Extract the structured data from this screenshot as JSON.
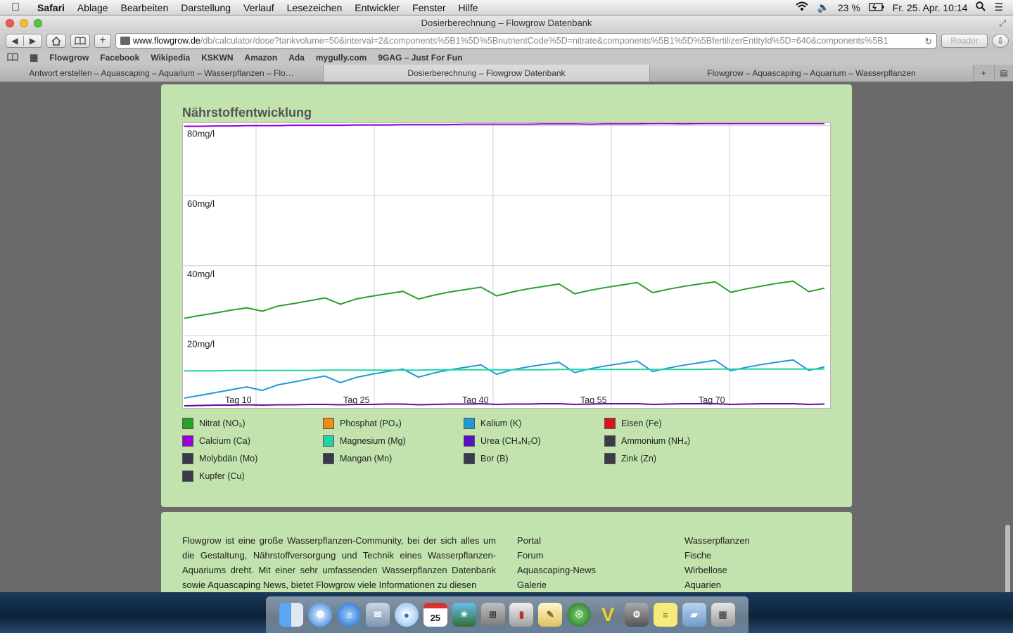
{
  "menubar": {
    "app": "Safari",
    "items": [
      "Ablage",
      "Bearbeiten",
      "Darstellung",
      "Verlauf",
      "Lesezeichen",
      "Entwickler",
      "Fenster",
      "Hilfe"
    ],
    "battery": "23 %",
    "clock": "Fr. 25. Apr.  10:14"
  },
  "window": {
    "title": "Dosierberechnung – Flowgrow Datenbank"
  },
  "toolbar": {
    "url_host": "www.flowgrow.de",
    "url_rest": "/db/calculator/dose?tankvolume=50&interval=2&components%5B1%5D%5BnutrientCode%5D=nitrate&components%5B1%5D%5BfertilizerEntityId%5D=640&components%5B1",
    "reader_label": "Reader"
  },
  "bookmarks": [
    "Flowgrow",
    "Facebook",
    "Wikipedia",
    "KSKWN",
    "Amazon",
    "Ada",
    "mygully.com",
    "9GAG – Just For Fun"
  ],
  "tabs": [
    {
      "label": "Antwort erstellen – Aquascaping – Aquarium – Wasserpflanzen – Flo…"
    },
    {
      "label": "Dosierberechnung – Flowgrow Datenbank"
    },
    {
      "label": "Flowgrow – Aquascaping – Aquarium – Wasserpflanzen"
    }
  ],
  "chart_section": {
    "title": "Nährstoffentwicklung"
  },
  "chart_data": {
    "type": "line",
    "title": "Nährstoffentwicklung",
    "x_tick_labels": [
      "Tag 10",
      "Tag 25",
      "Tag 40",
      "Tag 55",
      "Tag 70"
    ],
    "y_tick_labels": [
      "20mg/l",
      "40mg/l",
      "60mg/l",
      "80mg/l"
    ],
    "ylim": [
      0,
      80
    ],
    "grid": true,
    "series": [
      {
        "name": "Calcium (Ca)",
        "color": "#9b00d9",
        "values": [
          79.8,
          79.8,
          79.9,
          79.9,
          80.0,
          80.0,
          80.0,
          80.1,
          80.1,
          80.1,
          80.1,
          80.2,
          80.2,
          80.2,
          80.3,
          80.3,
          80.3,
          80.3,
          80.4,
          80.4,
          80.4,
          80.4,
          80.4,
          80.5,
          80.5,
          80.5,
          80.4,
          80.5,
          80.5,
          80.5,
          80.6,
          80.6,
          80.5,
          80.6,
          80.6,
          80.6,
          80.6,
          80.6,
          80.6,
          80.6,
          80.6,
          80.6
        ]
      },
      {
        "name": "Nitrat (NO3)",
        "color": "#2ca02c",
        "values": [
          25.0,
          25.8,
          26.5,
          27.3,
          28.0,
          27.0,
          28.5,
          29.2,
          30.0,
          30.8,
          29.0,
          30.5,
          31.3,
          32.0,
          32.7,
          30.5,
          31.6,
          32.5,
          33.2,
          33.9,
          31.4,
          32.5,
          33.4,
          34.1,
          34.8,
          32.0,
          33.0,
          33.8,
          34.5,
          35.2,
          32.3,
          33.3,
          34.1,
          34.8,
          35.4,
          32.4,
          33.4,
          34.2,
          35.0,
          35.6,
          32.6,
          33.6
        ]
      },
      {
        "name": "Kalium (K)",
        "color": "#1f9ad6",
        "values": [
          2.2,
          3.0,
          3.8,
          4.6,
          5.4,
          4.4,
          6.0,
          6.8,
          7.7,
          8.5,
          6.6,
          8.1,
          9.0,
          9.8,
          10.5,
          8.2,
          9.4,
          10.3,
          11.0,
          11.7,
          9.0,
          10.3,
          11.1,
          11.8,
          12.4,
          9.5,
          10.6,
          11.4,
          12.1,
          12.8,
          9.8,
          10.8,
          11.6,
          12.3,
          13.0,
          10.0,
          11.0,
          11.8,
          12.5,
          13.1,
          10.1,
          11.1
        ]
      },
      {
        "name": "Magnesium (Mg)",
        "color": "#21d4a8",
        "values": [
          10.0,
          10.0,
          10.0,
          10.1,
          10.1,
          10.1,
          10.1,
          10.1,
          10.1,
          10.2,
          10.2,
          10.2,
          10.2,
          10.2,
          10.2,
          10.2,
          10.3,
          10.3,
          10.3,
          10.3,
          10.3,
          10.3,
          10.3,
          10.3,
          10.4,
          10.4,
          10.4,
          10.4,
          10.4,
          10.4,
          10.4,
          10.4,
          10.4,
          10.4,
          10.5,
          10.5,
          10.5,
          10.5,
          10.5,
          10.5,
          10.5,
          10.5
        ]
      },
      {
        "name": "Urea (CH4N2O)",
        "color": "#5a0fa0",
        "values": [
          0.0,
          0.1,
          0.2,
          0.2,
          0.3,
          0.2,
          0.3,
          0.3,
          0.4,
          0.4,
          0.3,
          0.4,
          0.4,
          0.5,
          0.5,
          0.3,
          0.4,
          0.5,
          0.5,
          0.6,
          0.4,
          0.5,
          0.5,
          0.6,
          0.6,
          0.4,
          0.5,
          0.6,
          0.6,
          0.6,
          0.4,
          0.5,
          0.6,
          0.6,
          0.6,
          0.4,
          0.5,
          0.6,
          0.6,
          0.6,
          0.4,
          0.5
        ]
      }
    ]
  },
  "legend": [
    {
      "label": "Nitrat (NO₃)",
      "color": "#2ca02c"
    },
    {
      "label": "Phosphat (PO₄)",
      "color": "#f28c0f"
    },
    {
      "label": "Kalium (K)",
      "color": "#1f9ad6"
    },
    {
      "label": "Eisen (Fe)",
      "color": "#e0101e"
    },
    {
      "label": "Calcium (Ca)",
      "color": "#9b00d9"
    },
    {
      "label": "Magnesium (Mg)",
      "color": "#21d4a8"
    },
    {
      "label": "Urea (CH₄N₂O)",
      "color": "#5a0fc0"
    },
    {
      "label": "Ammonium (NH₄)",
      "color": "#3a3a4a"
    },
    {
      "label": "Molybdän (Mo)",
      "color": "#3a3a4a"
    },
    {
      "label": "Mangan (Mn)",
      "color": "#3a3a4a"
    },
    {
      "label": "Bor (B)",
      "color": "#3a3a4a"
    },
    {
      "label": "Zink (Zn)",
      "color": "#3a3a4a"
    },
    {
      "label": "Kupfer (Cu)",
      "color": "#3a3a4a"
    }
  ],
  "footer": {
    "about": "Flowgrow ist eine große Wasserpflanzen-Community, bei der sich alles um die Gestaltung, Nährstoffversorgung und Technik eines Wasserpflanzen-Aquariums dreht. Mit einer sehr umfassenden Wasserpflanzen Datenbank sowie Aquascaping News, bietet Flowgrow viele Informationen zu diesen",
    "col1": [
      "Portal",
      "Forum",
      "Aquascaping-News",
      "Galerie"
    ],
    "col2": [
      "Wasserpflanzen",
      "Fische",
      "Wirbellose",
      "Aquarien"
    ]
  },
  "dock": {
    "calendar_day": "25",
    "icons": [
      "finder-icon",
      "safari-icon",
      "itunes-icon",
      "mail-icon",
      "messages-icon",
      "calendar-icon",
      "photo-icon",
      "calculator-icon",
      "keynote-icon",
      "pages-icon",
      "network-icon",
      "vim-icon",
      "system-preferences-icon",
      "stickies-icon",
      "documents-folder-icon",
      "trash-icon"
    ]
  }
}
